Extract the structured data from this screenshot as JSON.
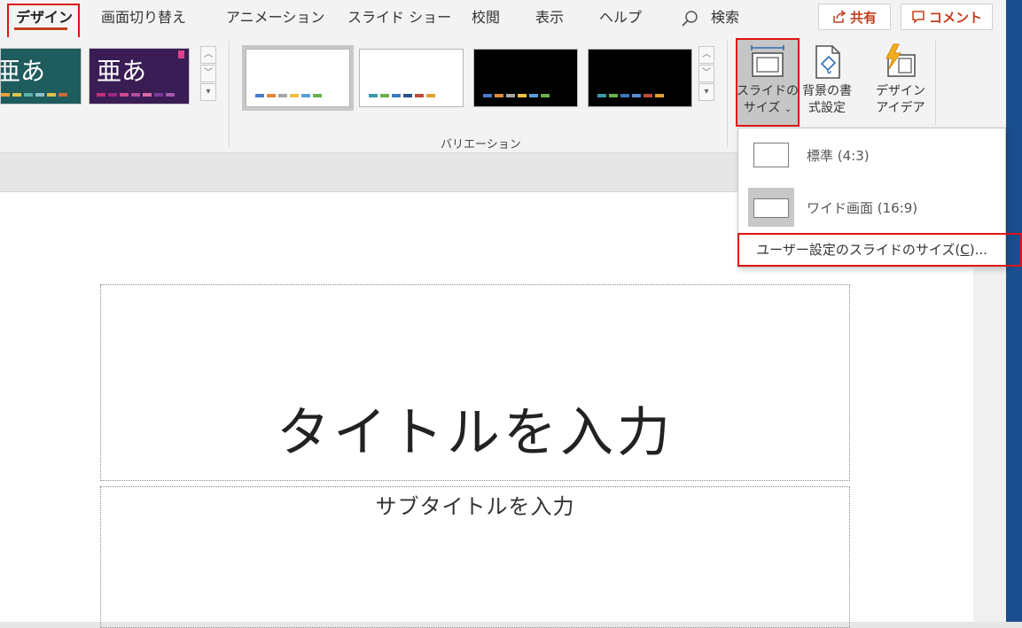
{
  "tabs": [
    {
      "id": "design",
      "label": "デザイン",
      "active": true
    },
    {
      "id": "transitions",
      "label": "画面切り替え"
    },
    {
      "id": "animations",
      "label": "アニメーション"
    },
    {
      "id": "slideshow",
      "label": "スライド ショー"
    },
    {
      "id": "review",
      "label": "校閲"
    },
    {
      "id": "view",
      "label": "表示"
    },
    {
      "id": "help",
      "label": "ヘルプ"
    }
  ],
  "search": {
    "label": "検索"
  },
  "share": {
    "label": "共有",
    "icon": "share-icon"
  },
  "comment": {
    "label": "コメント",
    "icon": "comment-icon"
  },
  "themes": {
    "items": [
      {
        "text": "亜あ",
        "bg": "#1f5c5e"
      },
      {
        "text": "亜あ",
        "bg": "#3a1d55"
      }
    ]
  },
  "variations": {
    "group_label": "バリエーション",
    "items": [
      {
        "bg": "#ffffff",
        "selected": true
      },
      {
        "bg": "#ffffff"
      },
      {
        "bg": "#000000"
      },
      {
        "bg": "#000000"
      }
    ]
  },
  "customize": {
    "slide_size": {
      "line1": "スライドの",
      "line2": "サイズ"
    },
    "format_background": {
      "line1": "背景の書",
      "line2": "式設定"
    },
    "design_ideas": {
      "line1": "デザイン",
      "line2": "アイデア"
    }
  },
  "dropdown": {
    "standard": "標準 (4:3)",
    "widescreen": "ワイド画面 (16:9)",
    "custom_prefix": "ユーザー設定のスライドのサイズ(",
    "custom_key": "C",
    "custom_suffix": ")..."
  },
  "slide": {
    "title_placeholder": "タイトルを入力",
    "subtitle_placeholder": "サブタイトルを入力"
  },
  "colors": {
    "accent": "#c43e1c",
    "highlight": "#e01414",
    "ribbon_bg": "#f3f3f3"
  }
}
